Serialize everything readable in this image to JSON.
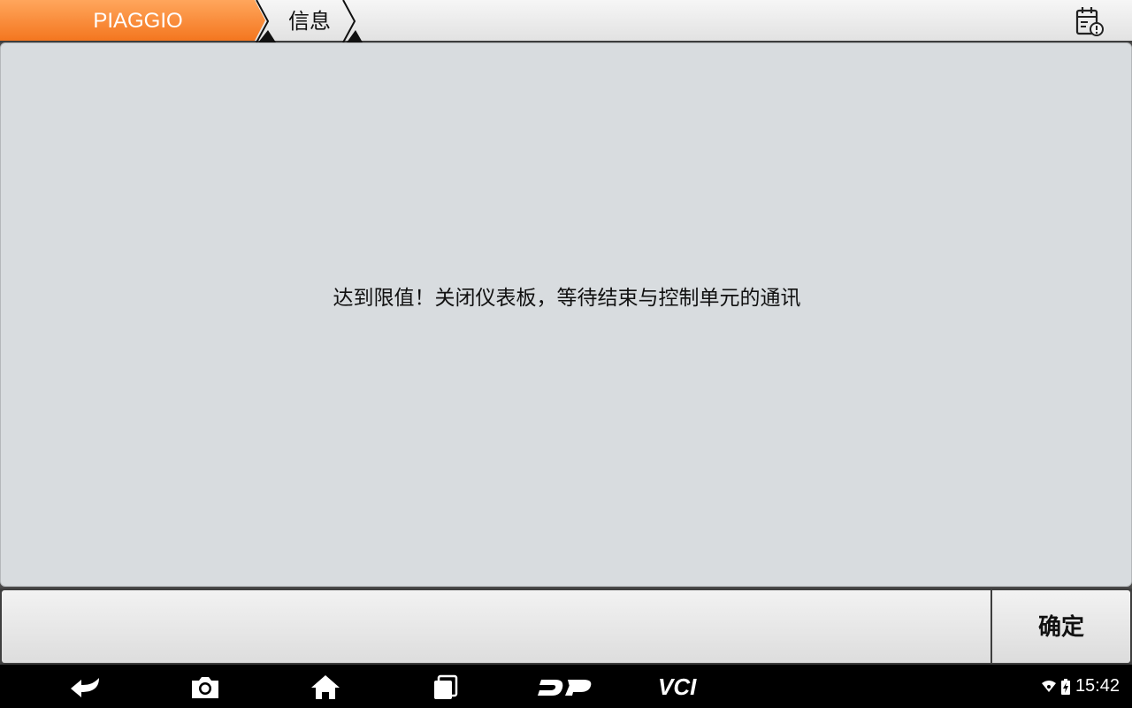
{
  "breadcrumb": {
    "home": "PIAGGIO",
    "current": "信息"
  },
  "topbar": {
    "right_icon": "calendar-alert-icon"
  },
  "message": {
    "text": "达到限值！关闭仪表板，等待结束与控制单元的通讯"
  },
  "buttons": {
    "confirm": "确定"
  },
  "navbar": {
    "items": [
      "back-icon",
      "camera-icon",
      "home-icon",
      "recent-apps-icon",
      "dp-icon",
      "vci-icon"
    ],
    "vci_label": "VCI"
  },
  "status": {
    "time": "15:42",
    "icons": [
      "wifi-icon",
      "battery-charging-icon"
    ]
  },
  "colors": {
    "accent": "#f4761f",
    "panel": "#d8dcdf",
    "navbar": "#000000"
  }
}
